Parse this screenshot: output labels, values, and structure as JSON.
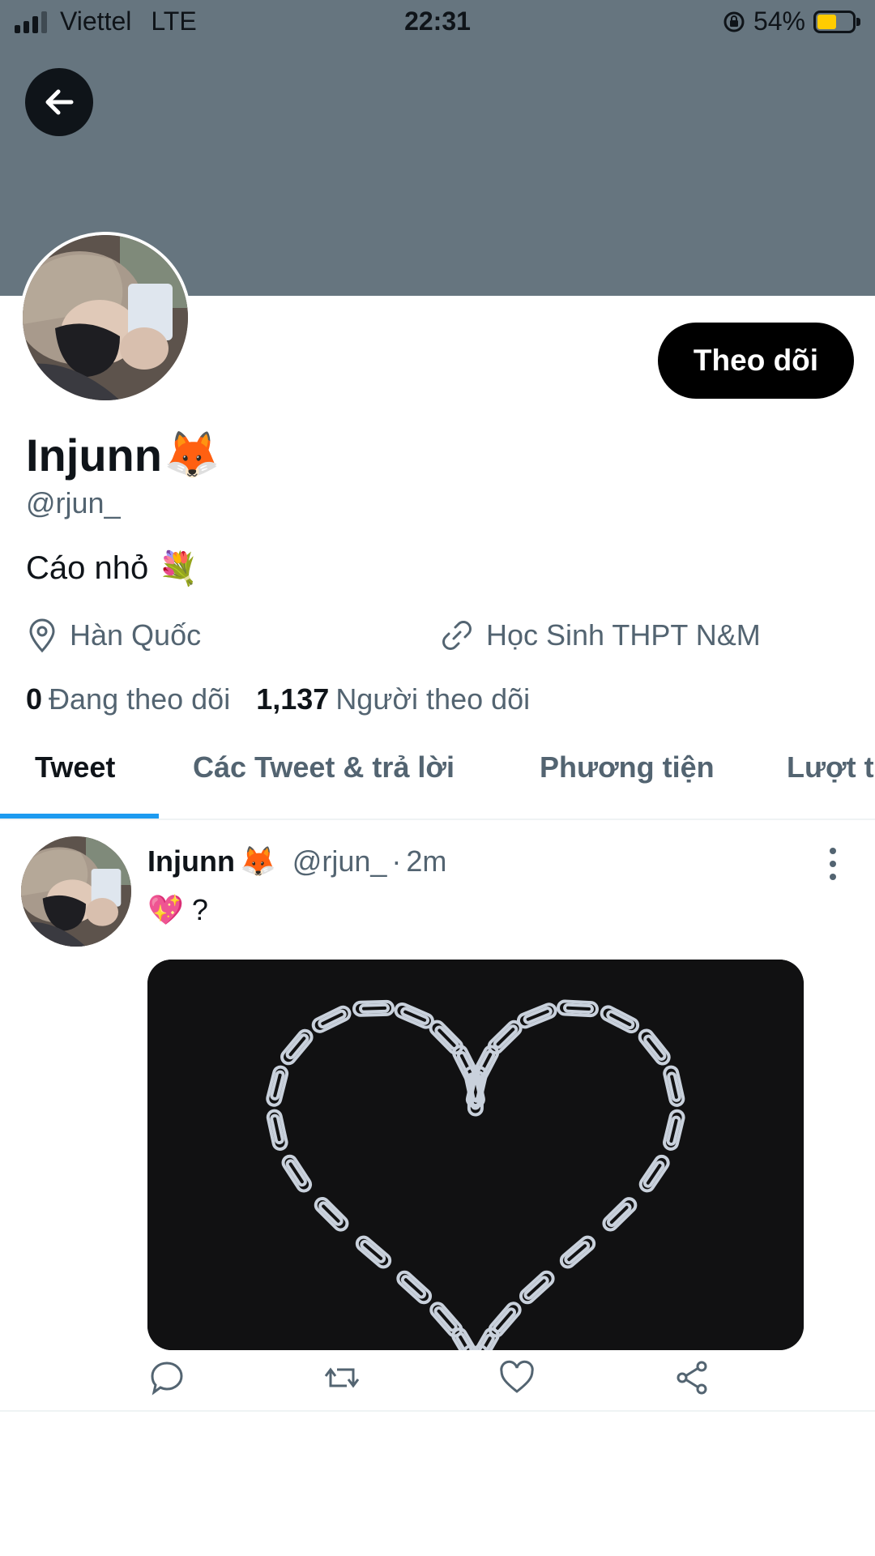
{
  "status_bar": {
    "carrier": "Viettel",
    "network": "LTE",
    "time": "22:31",
    "battery": "54%",
    "battery_level": 0.54
  },
  "colors": {
    "banner": "#66757f",
    "accent": "#1d9bf0",
    "muted": "#536471",
    "battery_fill": "#ffcc00"
  },
  "profile": {
    "follow_label": "Theo dõi",
    "display_name": "Injunn",
    "display_emoji": "🦊",
    "handle": "@rjun_",
    "bio_text": "Cáo nhỏ",
    "bio_emoji": "💐",
    "location": "Hàn Quốc",
    "link": "Học Sinh THPT N&M",
    "following_count": "0",
    "following_label": "Đang theo dõi",
    "followers_count": "1,137",
    "followers_label": "Người theo dõi"
  },
  "tabs": [
    {
      "label": "Tweet",
      "active": true
    },
    {
      "label": "Các Tweet & trả lời",
      "active": false
    },
    {
      "label": "Phương tiện",
      "active": false
    },
    {
      "label": "Lượt t",
      "active": false
    }
  ],
  "tweet": {
    "name": "Injunn",
    "name_emoji": "🦊",
    "handle": "@rjun_",
    "separator": "·",
    "time": "2m",
    "text_emoji": "💖",
    "text": "?",
    "media": "paperclip-heart-image"
  },
  "icons": [
    "back-arrow-icon",
    "location-icon",
    "link-icon",
    "more-icon",
    "reply-icon",
    "retweet-icon",
    "like-icon",
    "share-icon"
  ]
}
